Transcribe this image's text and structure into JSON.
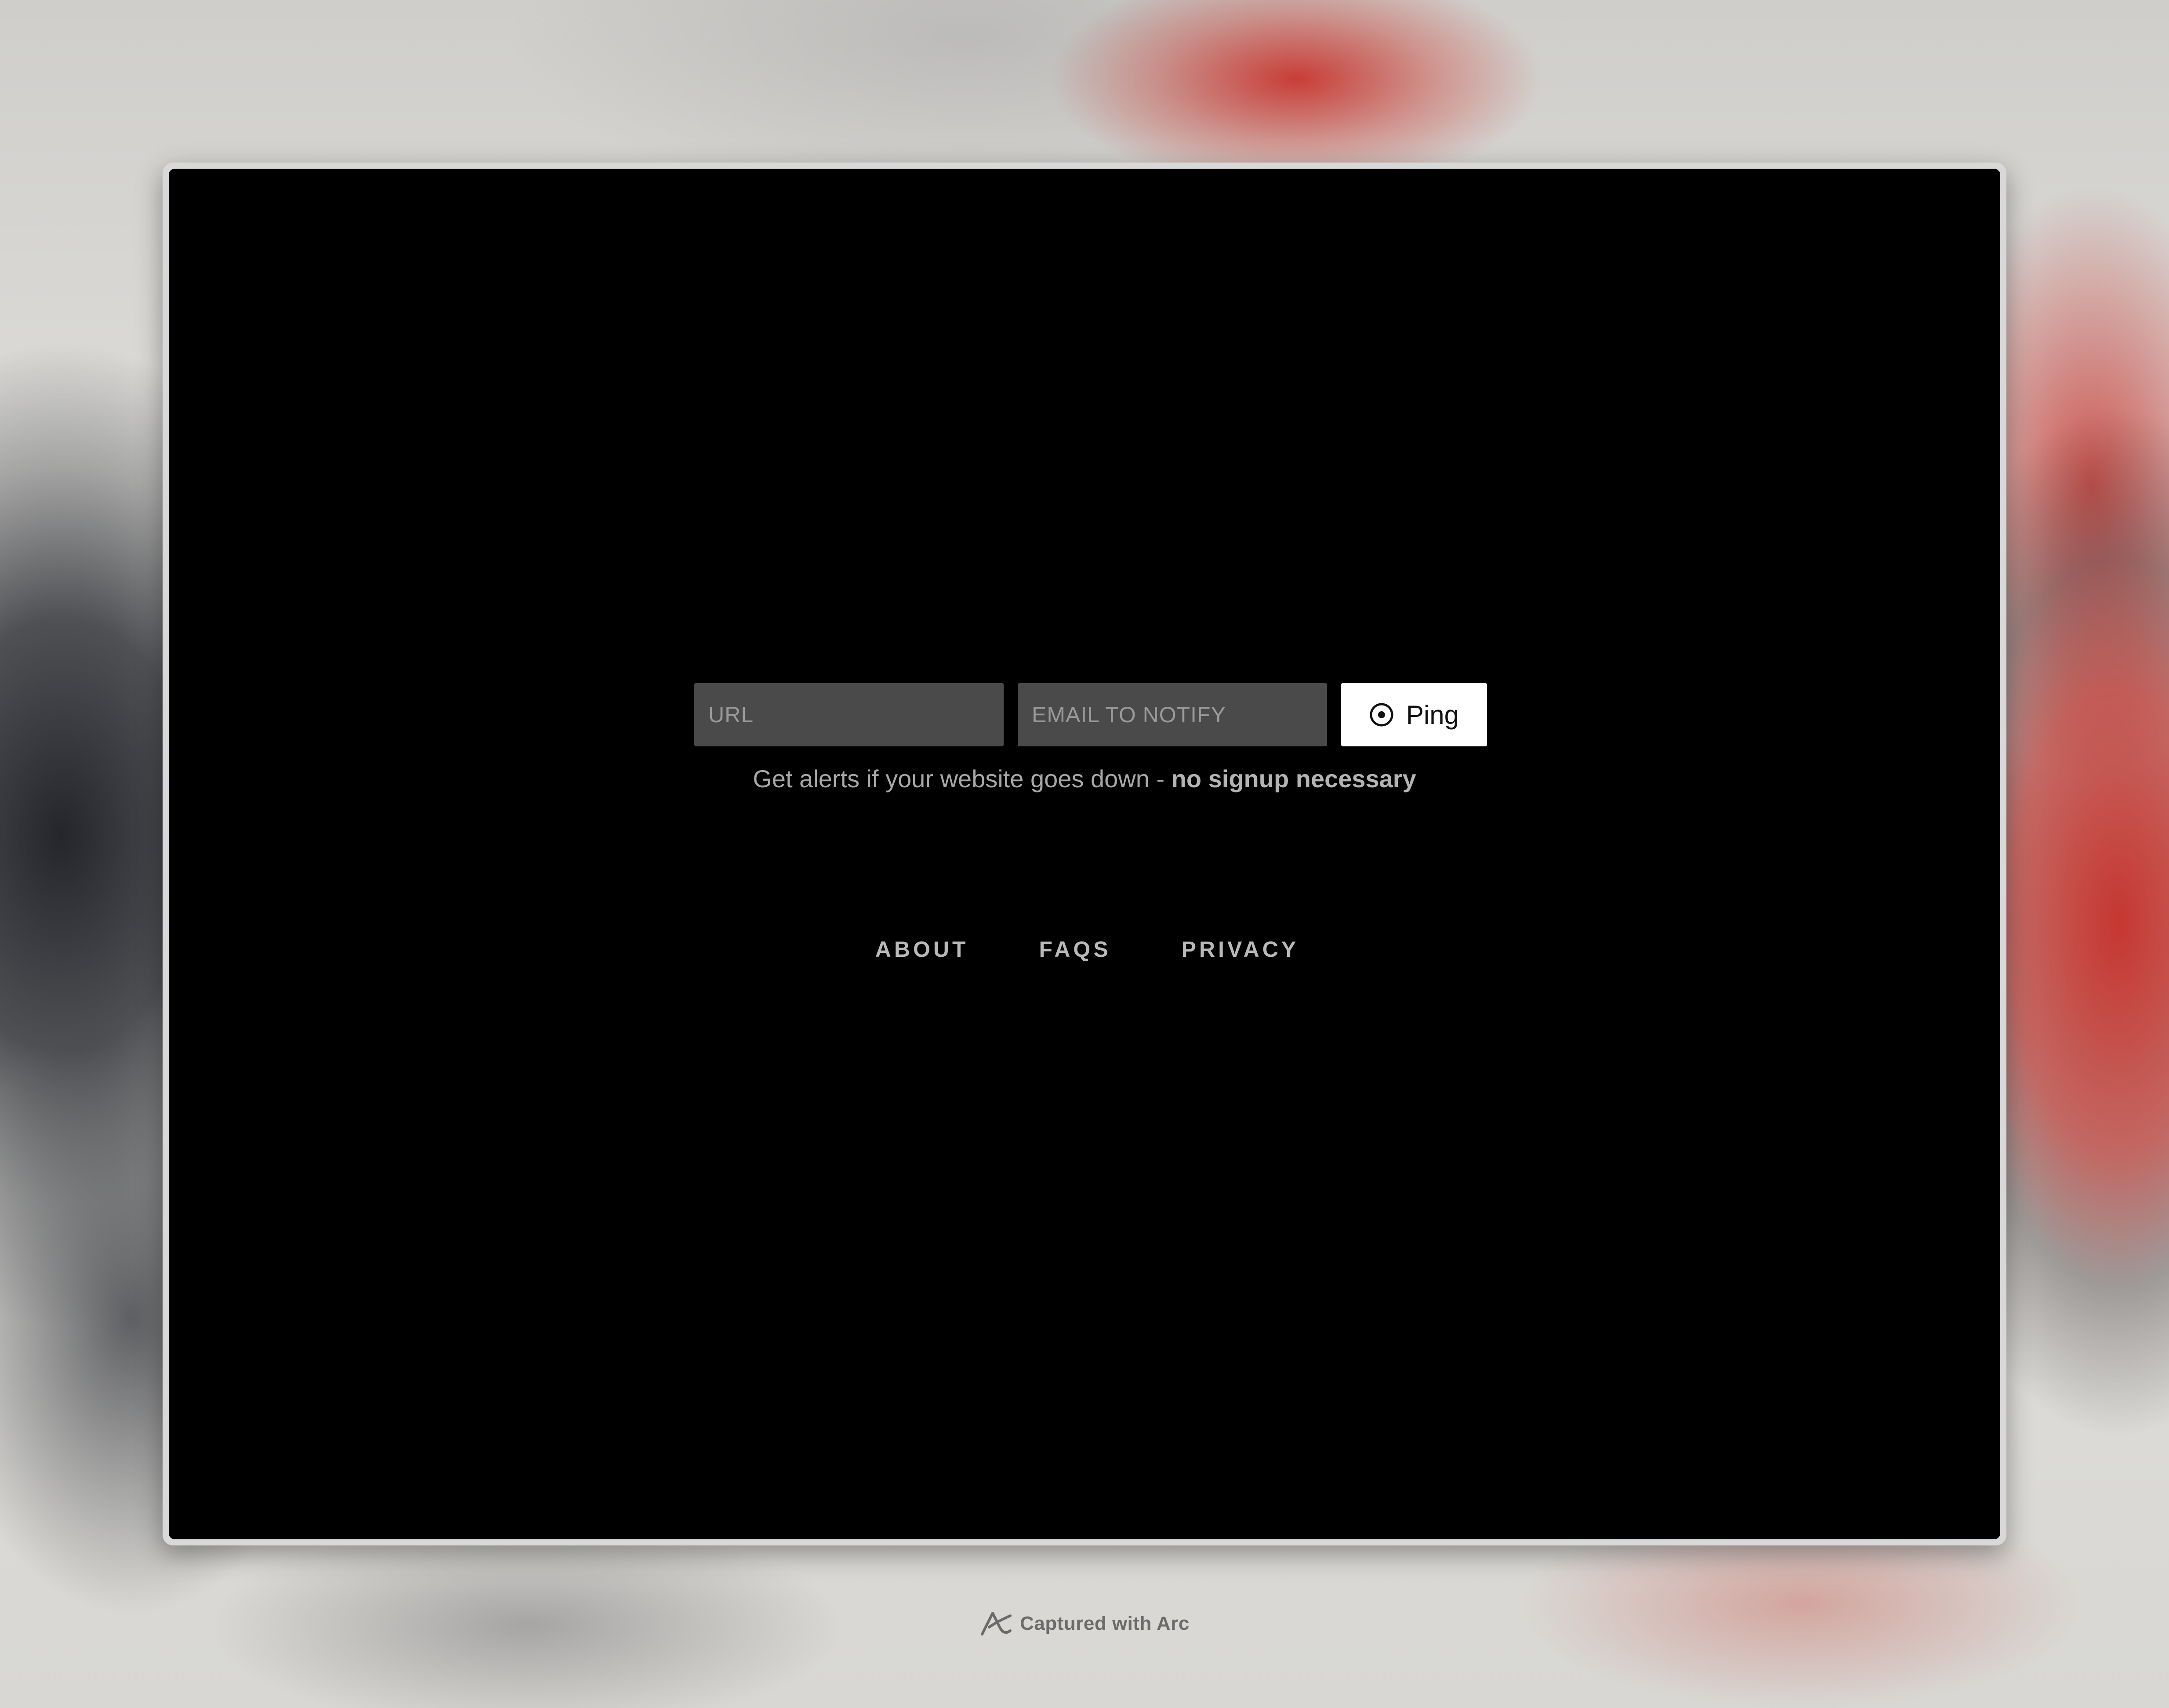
{
  "form": {
    "url_placeholder": "URL",
    "url_value": "",
    "email_placeholder": "EMAIL TO NOTIFY",
    "email_value": "",
    "submit_label": "Ping",
    "submit_icon": "radio-target-icon"
  },
  "tagline": {
    "prefix": "Get alerts if your website goes down - ",
    "emphasis": "no signup necessary"
  },
  "nav": {
    "items": [
      {
        "label": "ABOUT"
      },
      {
        "label": "FAQS"
      },
      {
        "label": "PRIVACY"
      }
    ]
  },
  "credit": {
    "text": "Captured with Arc",
    "icon": "arc-logo-icon"
  },
  "colors": {
    "page_background": "#000000",
    "input_background": "#4a4a4a",
    "button_background": "#ffffff",
    "muted_text": "#a8a8a8"
  }
}
